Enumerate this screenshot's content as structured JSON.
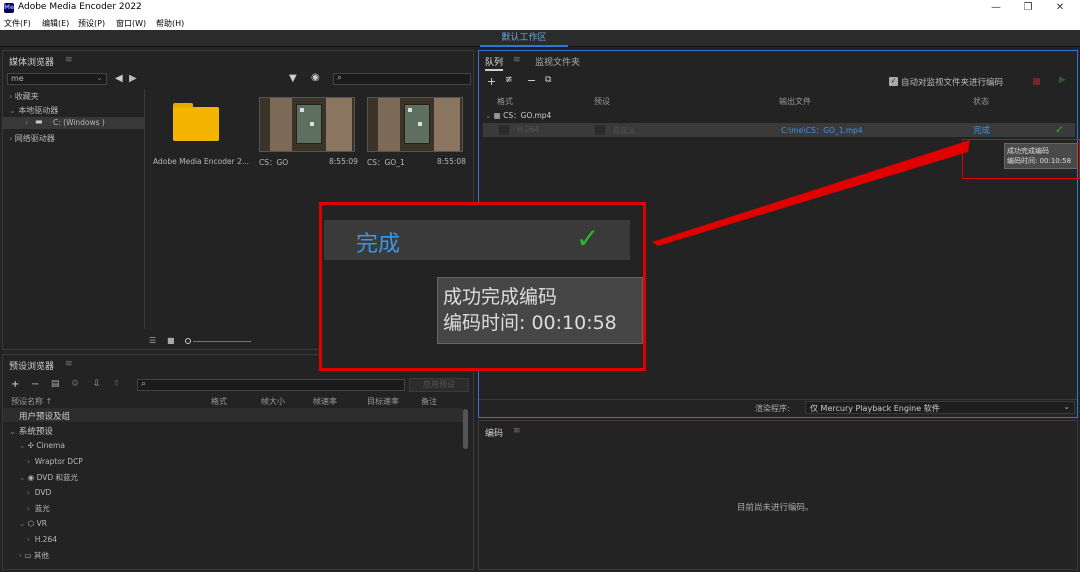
{
  "app": {
    "title": "Adobe Media Encoder 2022",
    "logo": "Me"
  },
  "window_controls": {
    "min": "—",
    "max": "❐",
    "close": "✕"
  },
  "menu": [
    "文件(F)",
    "编辑(E)",
    "预设(P)",
    "窗口(W)",
    "帮助(H)"
  ],
  "workspace": {
    "label": "默认工作区"
  },
  "media_browser": {
    "title": "媒体浏览器",
    "menu_glyph": "≡",
    "location": "me",
    "search_glyph": "⌕",
    "tree": [
      "收藏夹",
      "本地驱动器",
      "C: (Windows )",
      "网络驱动器"
    ],
    "items": [
      {
        "name": "Adobe Media Encoder 2...",
        "time": ""
      },
      {
        "name": "CS：GO",
        "time": "8:55:09"
      },
      {
        "name": "CS：GO_1",
        "time": "8:55:08"
      }
    ]
  },
  "preset_browser": {
    "title": "预设浏览器",
    "menu_glyph": "≡",
    "apply_button": "应用预设",
    "columns": [
      "预设名称 ↑",
      "格式",
      "帧大小",
      "帧速率",
      "目标速率",
      "备注"
    ],
    "rows": [
      {
        "label": "用户预设及组",
        "indent": 0,
        "icon": ""
      },
      {
        "label": "系统预设",
        "indent": 0,
        "icon": "chevron-down"
      },
      {
        "label": "Cinema",
        "indent": 1,
        "icon": "cinema"
      },
      {
        "label": "Wraptor DCP",
        "indent": 2,
        "icon": ""
      },
      {
        "label": "DVD 和蓝光",
        "indent": 1,
        "icon": "disc"
      },
      {
        "label": "DVD",
        "indent": 2,
        "icon": ""
      },
      {
        "label": "蓝光",
        "indent": 2,
        "icon": ""
      },
      {
        "label": "VR",
        "indent": 1,
        "icon": "vr"
      },
      {
        "label": "H.264",
        "indent": 2,
        "icon": ""
      },
      {
        "label": "其他",
        "indent": 1,
        "icon": "monitor"
      }
    ]
  },
  "queue": {
    "tabs": [
      "队列",
      "监视文件夹"
    ],
    "menu_glyph": "≡",
    "auto_encode": "自动对监视文件夹进行编码",
    "columns": [
      "格式",
      "预设",
      "输出文件",
      "状态"
    ],
    "source": "CS：GO.mp4",
    "item": {
      "format": "H.264",
      "preset": "自定义",
      "output": "C:\\me\\CS：GO_1.mp4",
      "status": "完成",
      "check": "✓"
    },
    "tooltip": {
      "line1": "成功完成编码",
      "line2": "编码时间: 00:10:58"
    },
    "renderer_label": "渲染程序:",
    "renderer_value": "仅 Mercury Playback Engine 软件"
  },
  "encoding": {
    "title": "编码",
    "menu_glyph": "≡",
    "status": "目前尚未进行编码。"
  },
  "zoom": {
    "status": "完成",
    "check": "✓",
    "tooltip_line1": "成功完成编码",
    "tooltip_line2": "编码时间: 00:10:58"
  },
  "colors": {
    "accent": "#2f77d4",
    "status_blue": "#3d95e6",
    "check_green": "#2db52d",
    "annotation_red": "#e00000"
  }
}
